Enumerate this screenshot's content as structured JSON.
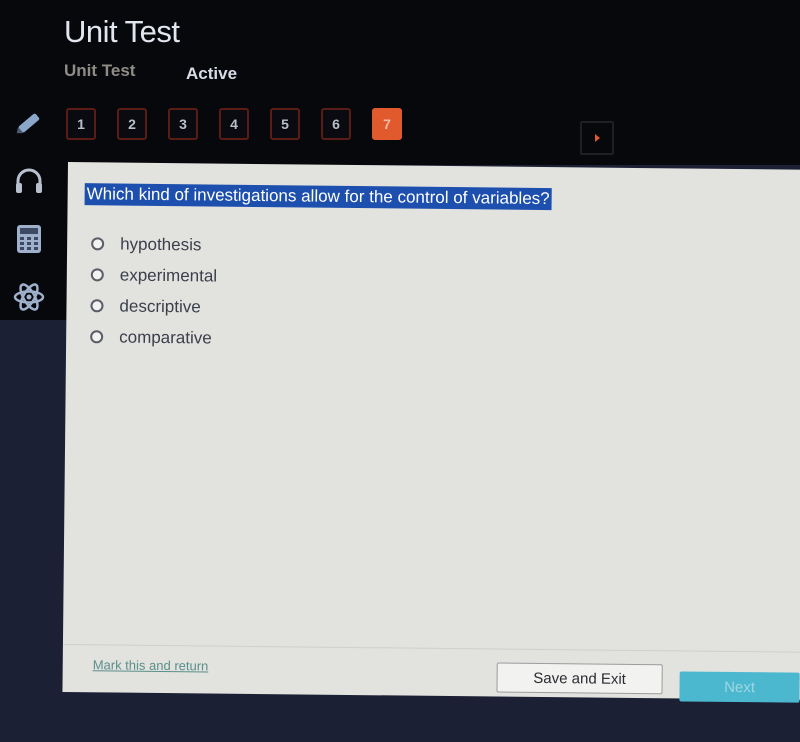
{
  "header": {
    "title": "Unit Test",
    "subtitle": "Unit Test",
    "status": "Active"
  },
  "question_nav": {
    "items": [
      {
        "label": "1",
        "current": false
      },
      {
        "label": "2",
        "current": false
      },
      {
        "label": "3",
        "current": false
      },
      {
        "label": "4",
        "current": false
      },
      {
        "label": "5",
        "current": false
      },
      {
        "label": "6",
        "current": false
      },
      {
        "label": "7",
        "current": true
      }
    ],
    "next_arrow_icon": "play-arrow-icon"
  },
  "tools": [
    {
      "name": "pencil-icon"
    },
    {
      "name": "headphones-icon"
    },
    {
      "name": "calculator-icon"
    },
    {
      "name": "atom-icon"
    }
  ],
  "question": {
    "text": "Which kind of investigations allow for the control of variables?",
    "options": [
      "hypothesis",
      "experimental",
      "descriptive",
      "comparative"
    ]
  },
  "footer": {
    "mark_link": "Mark this and return",
    "save_exit": "Save and Exit",
    "next": "Next"
  },
  "colors": {
    "accent": "#e05a2e",
    "selection": "#1c4fae",
    "next_button": "#4cb8cf"
  }
}
